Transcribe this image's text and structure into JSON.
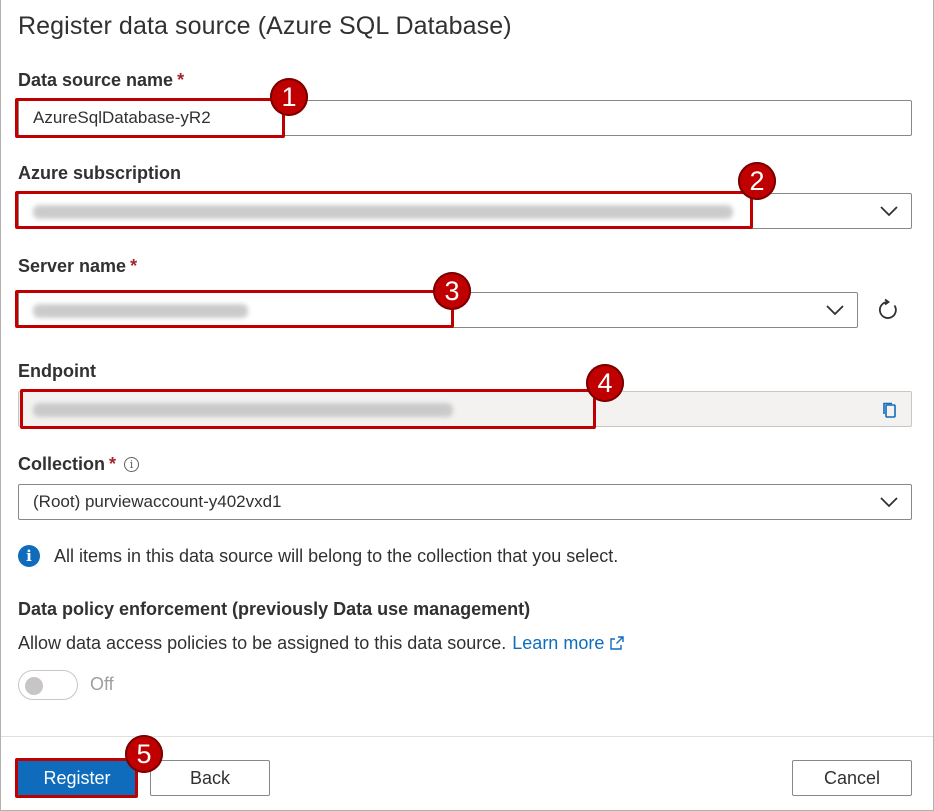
{
  "panel": {
    "title": "Register data source (Azure SQL Database)"
  },
  "fields": {
    "data_source_name": {
      "label": "Data source name",
      "required": "*",
      "value": "AzureSqlDatabase-yR2"
    },
    "azure_subscription": {
      "label": "Azure subscription"
    },
    "server_name": {
      "label": "Server name",
      "required": "*"
    },
    "endpoint": {
      "label": "Endpoint"
    },
    "collection": {
      "label": "Collection",
      "required": "*",
      "info": "i",
      "value": "(Root) purviewaccount-y402vxd1"
    }
  },
  "info_message": {
    "icon": "i",
    "text": "All items in this data source will belong to the collection that you select."
  },
  "policy": {
    "heading": "Data policy enforcement (previously Data use management)",
    "description": "Allow data access policies to be assigned to this data source.",
    "link": "Learn more",
    "toggle_state": "Off"
  },
  "footer": {
    "register": "Register",
    "back": "Back",
    "cancel": "Cancel"
  },
  "callouts": [
    "1",
    "2",
    "3",
    "4",
    "5"
  ],
  "colors": {
    "accent": "#0f6cbd",
    "callout": "#c00000",
    "required": "#a4262c"
  }
}
